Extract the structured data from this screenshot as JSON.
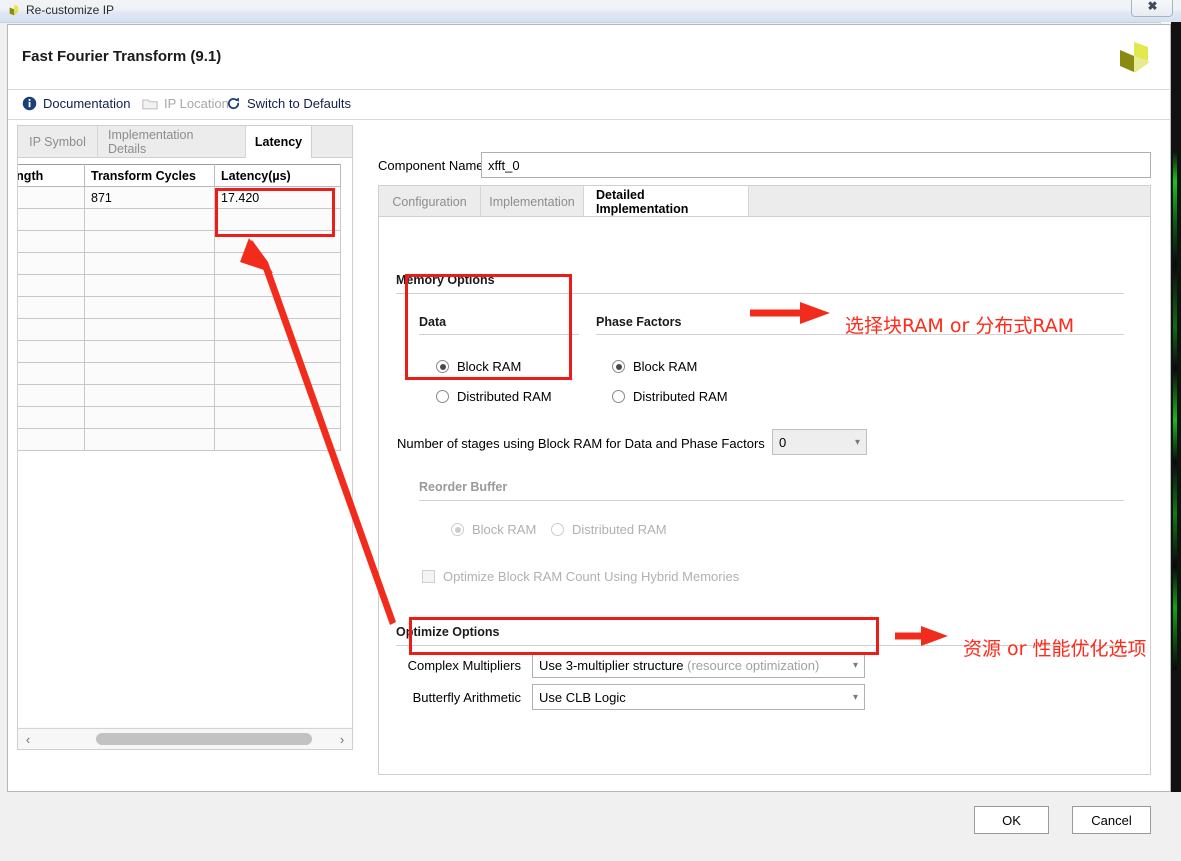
{
  "os_window": {
    "title": "Re-customize IP",
    "close_label": "✖",
    "app_icon": "xilinx-logo-icon"
  },
  "dialog": {
    "title": "Fast Fourier Transform (9.1)",
    "logo": "xilinx-logo-icon"
  },
  "toolbar": {
    "documentation": "Documentation",
    "ip_location": "IP Location",
    "switch_to_defaults": "Switch to Defaults"
  },
  "left_panel": {
    "tabs": [
      {
        "label": "IP Symbol",
        "active": false
      },
      {
        "label": "Implementation Details",
        "active": false
      },
      {
        "label": "Latency",
        "active": true
      }
    ],
    "table": {
      "columns": [
        "m Length",
        "Transform Cycles",
        "Latency(µs)"
      ],
      "rows": [
        [
          "",
          "871",
          "17.420"
        ],
        [
          "",
          "",
          ""
        ],
        [
          "",
          "",
          ""
        ],
        [
          "",
          "",
          ""
        ],
        [
          "",
          "",
          ""
        ],
        [
          "",
          "",
          ""
        ],
        [
          "",
          "",
          ""
        ],
        [
          "",
          "",
          ""
        ],
        [
          "",
          "",
          ""
        ],
        [
          "",
          "",
          ""
        ],
        [
          "",
          "",
          ""
        ],
        [
          "",
          "",
          ""
        ]
      ]
    },
    "hscroll": {
      "left_arrow": "‹",
      "right_arrow": "›"
    }
  },
  "component": {
    "label": "Component Name",
    "value": "xfft_0"
  },
  "right_panel": {
    "tabs": [
      {
        "label": "Configuration",
        "active": false
      },
      {
        "label": "Implementation",
        "active": false
      },
      {
        "label": "Detailed Implementation",
        "active": true
      }
    ],
    "memory_options": {
      "section_title": "Memory Options",
      "data": {
        "group_title": "Data",
        "options": [
          {
            "label": "Block RAM",
            "selected": true
          },
          {
            "label": "Distributed RAM",
            "selected": false
          }
        ]
      },
      "phase_factors": {
        "group_title": "Phase Factors",
        "options": [
          {
            "label": "Block RAM",
            "selected": true
          },
          {
            "label": "Distributed RAM",
            "selected": false
          }
        ]
      },
      "stages": {
        "label": "Number of stages using Block RAM for Data and Phase Factors",
        "value": "0"
      },
      "reorder_buffer": {
        "group_title": "Reorder Buffer",
        "options": [
          {
            "label": "Block RAM",
            "selected": true
          },
          {
            "label": "Distributed RAM",
            "selected": false
          }
        ],
        "checkbox": {
          "label": "Optimize Block RAM Count Using Hybrid Memories",
          "checked": false
        }
      }
    },
    "optimize_options": {
      "section_title": "Optimize Options",
      "complex_multipliers": {
        "label": "Complex Multipliers",
        "value": "Use 3-multiplier structure",
        "value_suffix": "(resource optimization)"
      },
      "butterfly_arithmetic": {
        "label": "Butterfly Arithmetic",
        "value": "Use CLB Logic"
      }
    }
  },
  "annotations": {
    "ram_note": "选择块RAM or 分布式RAM",
    "optimize_note": "资源 or 性能优化选项",
    "highlight_color": "#ec1c18",
    "text_color": "#ff2a1a"
  },
  "footer": {
    "ok": "OK",
    "cancel": "Cancel"
  }
}
